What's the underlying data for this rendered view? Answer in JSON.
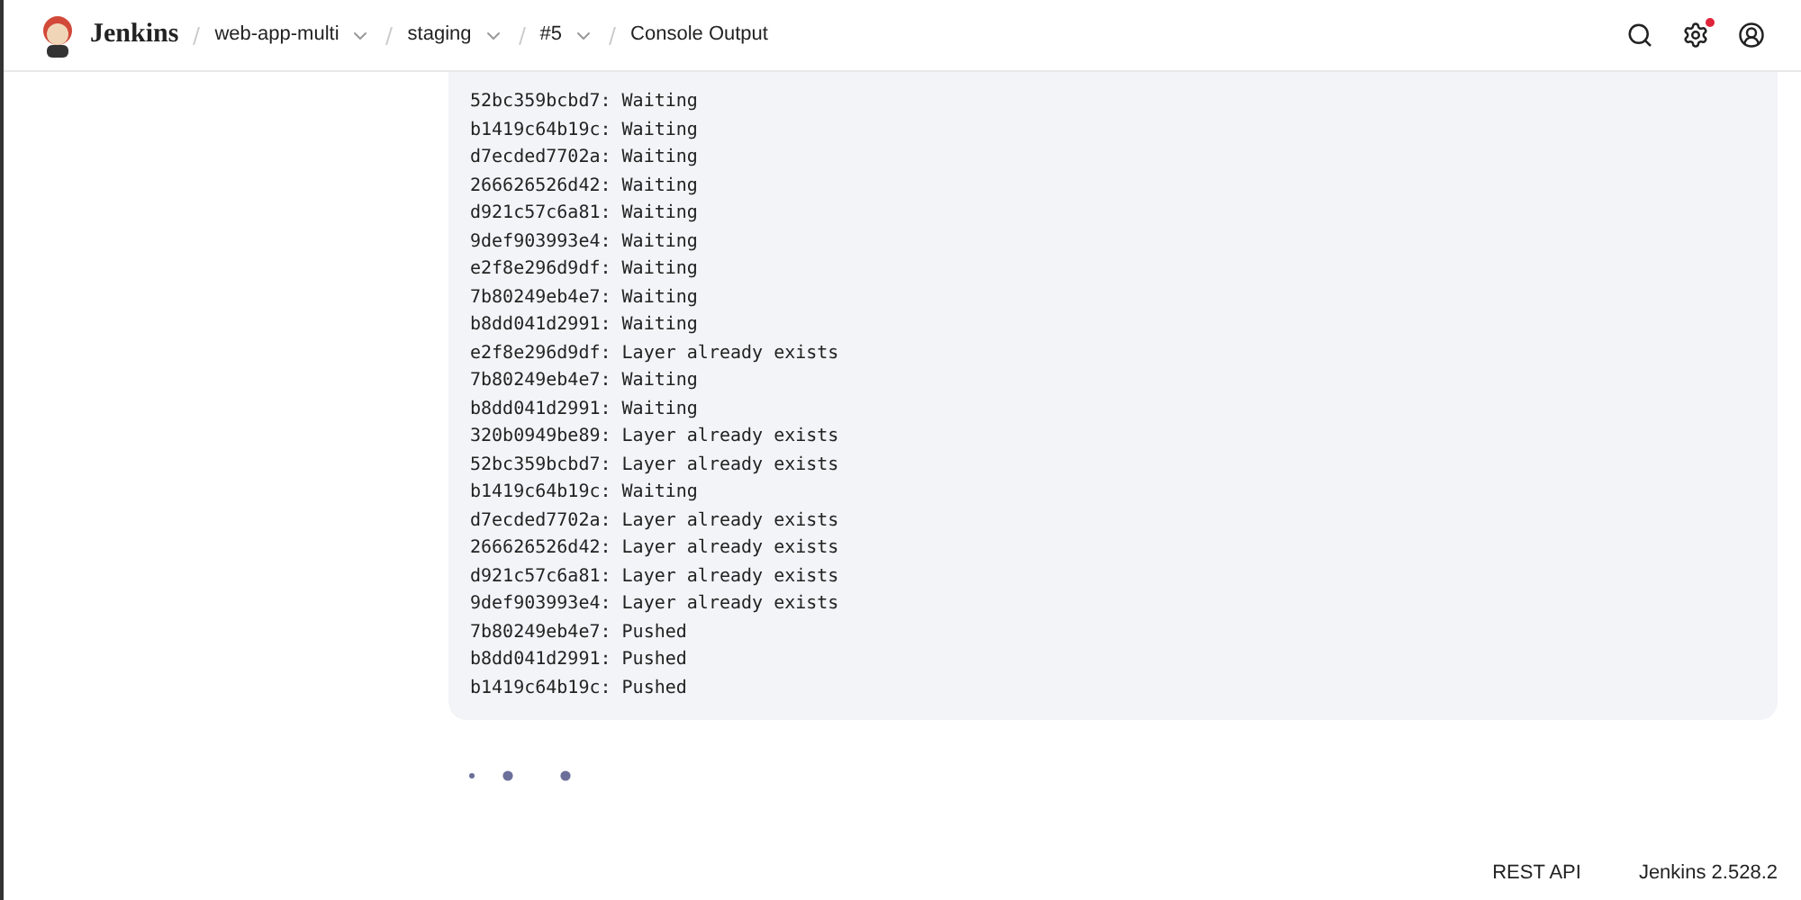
{
  "header": {
    "brand": "Jenkins",
    "breadcrumbs": [
      {
        "label": "web-app-multi",
        "has_menu": true
      },
      {
        "label": "staging",
        "has_menu": true
      },
      {
        "label": "#5",
        "has_menu": true
      },
      {
        "label": "Console Output",
        "has_menu": false
      }
    ],
    "settings_alert": true
  },
  "console": {
    "lines": [
      "52bc359bcbd7: Waiting",
      "b1419c64b19c: Waiting",
      "d7ecded7702a: Waiting",
      "266626526d42: Waiting",
      "d921c57c6a81: Waiting",
      "9def903993e4: Waiting",
      "e2f8e296d9df: Waiting",
      "7b80249eb4e7: Waiting",
      "b8dd041d2991: Waiting",
      "e2f8e296d9df: Layer already exists",
      "7b80249eb4e7: Waiting",
      "b8dd041d2991: Waiting",
      "320b0949be89: Layer already exists",
      "52bc359bcbd7: Layer already exists",
      "b1419c64b19c: Waiting",
      "d7ecded7702a: Layer already exists",
      "266626526d42: Layer already exists",
      "d921c57c6a81: Layer already exists",
      "9def903993e4: Layer already exists",
      "7b80249eb4e7: Pushed",
      "b8dd041d2991: Pushed",
      "b1419c64b19c: Pushed"
    ]
  },
  "footer": {
    "links": [
      "REST API"
    ],
    "version": "Jenkins 2.528.2"
  }
}
